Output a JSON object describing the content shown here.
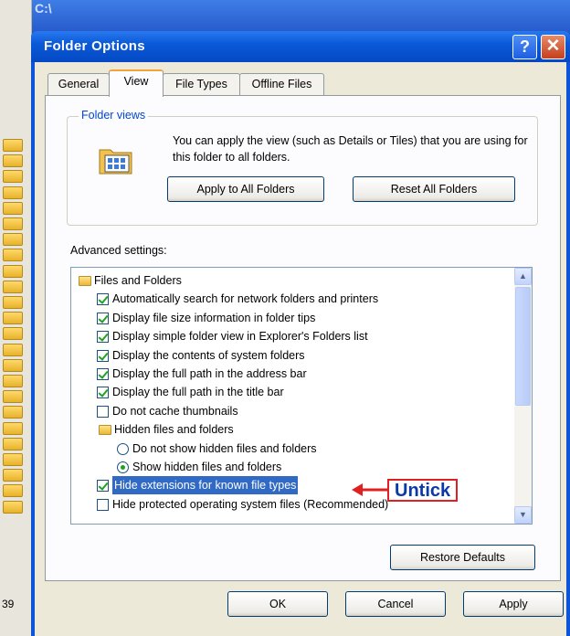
{
  "background": {
    "window_title": "C:\\",
    "status_number": "39"
  },
  "dialog": {
    "title": "Folder Options",
    "help_label": "?",
    "close_label": "✕"
  },
  "tabs": [
    {
      "label": "General",
      "selected": false
    },
    {
      "label": "View",
      "selected": true
    },
    {
      "label": "File Types",
      "selected": false
    },
    {
      "label": "Offline Files",
      "selected": false
    }
  ],
  "folder_views": {
    "legend": "Folder views",
    "description": "You can apply the view (such as Details or Tiles) that you are using for this folder to all folders.",
    "apply_all_label": "Apply to All Folders",
    "reset_all_label": "Reset All Folders"
  },
  "advanced": {
    "label": "Advanced settings:",
    "items": [
      {
        "text": "Files and Folders",
        "kind": "folder",
        "checked": null
      },
      {
        "text": "Automatically search for network folders and printers",
        "kind": "checkbox",
        "checked": true
      },
      {
        "text": "Display file size information in folder tips",
        "kind": "checkbox",
        "checked": true
      },
      {
        "text": "Display simple folder view in Explorer's Folders list",
        "kind": "checkbox",
        "checked": true
      },
      {
        "text": "Display the contents of system folders",
        "kind": "checkbox",
        "checked": true
      },
      {
        "text": "Display the full path in the address bar",
        "kind": "checkbox",
        "checked": true
      },
      {
        "text": "Display the full path in the title bar",
        "kind": "checkbox",
        "checked": true
      },
      {
        "text": "Do not cache thumbnails",
        "kind": "checkbox",
        "checked": false
      },
      {
        "text": "Hidden files and folders",
        "kind": "folder",
        "checked": null
      },
      {
        "text": "Do not show hidden files and folders",
        "kind": "radio",
        "checked": false
      },
      {
        "text": "Show hidden files and folders",
        "kind": "radio",
        "checked": true
      },
      {
        "text": "Hide extensions for known file types",
        "kind": "checkbox",
        "checked": true,
        "highlighted": true
      },
      {
        "text": "Hide protected operating system files (Recommended)",
        "kind": "checkbox",
        "checked": false
      }
    ],
    "restore_label": "Restore Defaults"
  },
  "annotation": {
    "label": "Untick",
    "color": "#e02020"
  },
  "footer": {
    "ok_label": "OK",
    "cancel_label": "Cancel",
    "apply_label": "Apply"
  },
  "colors": {
    "titlebar": "#0a5ad8",
    "dialog_face": "#ece9d8",
    "selection": "#316ac5",
    "check": "#21a121"
  }
}
